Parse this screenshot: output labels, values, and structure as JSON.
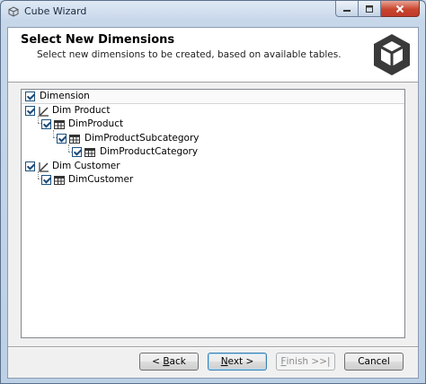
{
  "window": {
    "title": "Cube Wizard"
  },
  "header": {
    "title": "Select New Dimensions",
    "subtitle": "Select new dimensions to be created, based on available tables."
  },
  "tree": {
    "column_header": "Dimension",
    "nodes": [
      {
        "label": "Dim Product",
        "type": "dimension",
        "checked": true
      },
      {
        "label": "DimProduct",
        "type": "table",
        "checked": true
      },
      {
        "label": "DimProductSubcategory",
        "type": "table",
        "checked": true
      },
      {
        "label": "DimProductCategory",
        "type": "table",
        "checked": true
      },
      {
        "label": "Dim Customer",
        "type": "dimension",
        "checked": true
      },
      {
        "label": "DimCustomer",
        "type": "table",
        "checked": true
      }
    ]
  },
  "buttons": {
    "back": {
      "prefix": "< ",
      "accel": "B",
      "rest": "ack"
    },
    "next": {
      "accel": "N",
      "rest": "ext >"
    },
    "finish": {
      "accel": "F",
      "rest": "inish >>|"
    },
    "cancel": "Cancel"
  },
  "colors": {
    "titlebar": "#c7d7ea",
    "close_button": "#c8452f",
    "checkbox_border": "#1c5180"
  }
}
